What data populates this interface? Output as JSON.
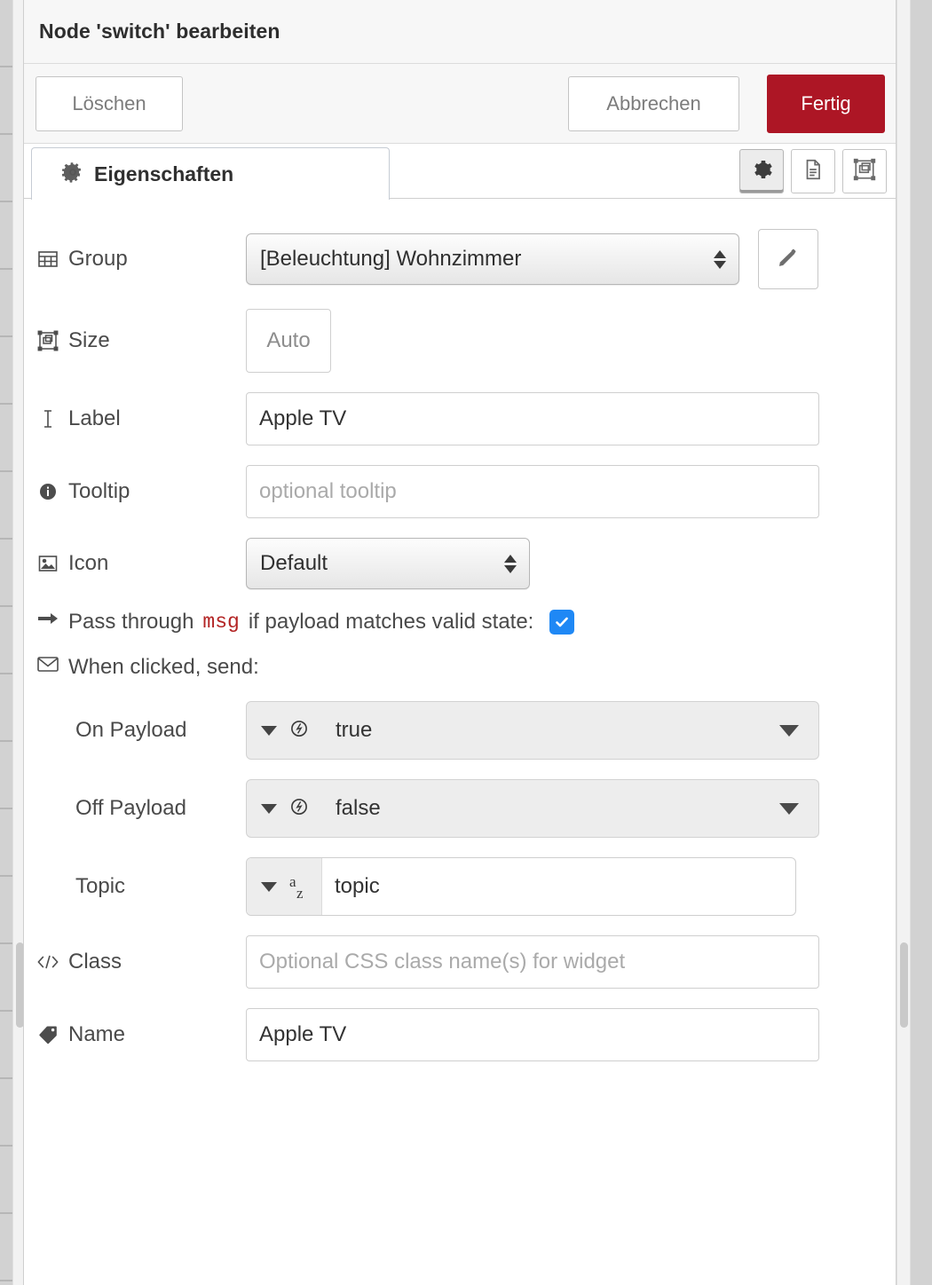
{
  "window": {
    "title": "Node 'switch' bearbeiten"
  },
  "toolbar": {
    "delete_label": "Löschen",
    "cancel_label": "Abbrechen",
    "done_label": "Fertig",
    "done_color": "#ad1625"
  },
  "tabs": {
    "active_tab": "Eigenschaften",
    "items": [
      {
        "label": "Eigenschaften",
        "icon": "gear-icon",
        "active": true
      }
    ],
    "icon_buttons": [
      {
        "name": "properties-tab-icon",
        "icon": "gear-icon",
        "active": true
      },
      {
        "name": "description-tab-icon",
        "icon": "document-icon",
        "active": false
      },
      {
        "name": "appearance-tab-icon",
        "icon": "appearance-icon",
        "active": false
      }
    ]
  },
  "form": {
    "group": {
      "label": "Group",
      "icon": "table-icon",
      "value": "[Beleuchtung] Wohnzimmer",
      "edit_button_icon": "pencil-icon"
    },
    "size": {
      "label": "Size",
      "icon": "resize-icon",
      "value": "Auto"
    },
    "label": {
      "label": "Label",
      "icon": "text-cursor-icon",
      "value": "Apple TV"
    },
    "tooltip": {
      "label": "Tooltip",
      "icon": "info-icon",
      "value": "",
      "placeholder": "optional tooltip"
    },
    "icon": {
      "label": "Icon",
      "icon": "image-icon",
      "value": "Default"
    },
    "passthrough": {
      "icon": "arrow-right-icon",
      "text_before": "Pass through",
      "code": "msg",
      "text_after": "if payload matches valid state:",
      "checked": true,
      "checkbox_color": "#1f88f5"
    },
    "when_clicked": {
      "icon": "envelope-icon",
      "label": "When clicked, send:"
    },
    "on_payload": {
      "label": "On Payload",
      "type_icon": "boolean-icon",
      "value": "true"
    },
    "off_payload": {
      "label": "Off Payload",
      "type_icon": "boolean-icon",
      "value": "false"
    },
    "topic": {
      "label": "Topic",
      "type_icon": "string-az-icon",
      "value": "topic"
    },
    "class": {
      "label": "Class",
      "icon": "code-icon",
      "value": "",
      "placeholder": "Optional CSS class name(s) for widget"
    },
    "name": {
      "label": "Name",
      "icon": "tag-icon",
      "value": "Apple TV"
    }
  }
}
